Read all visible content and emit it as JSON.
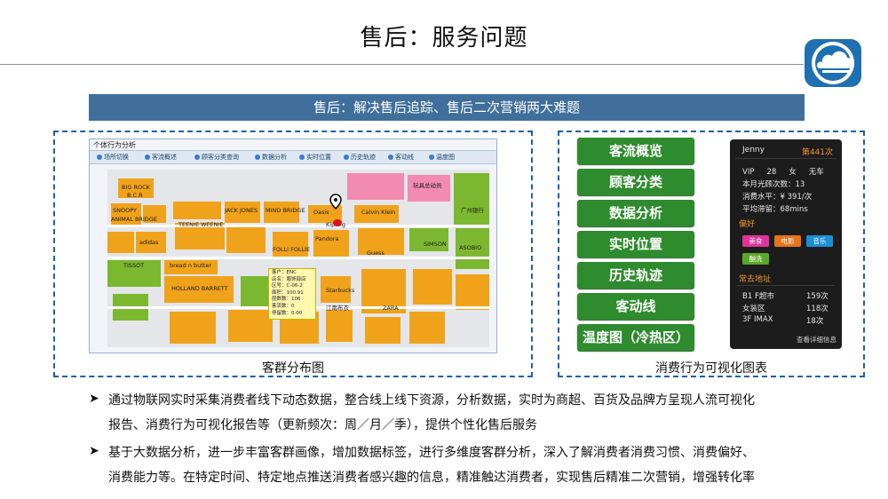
{
  "page": {
    "title": "售后：服务问题"
  },
  "banner": {
    "text": "售后：解决售后追踪、售后二次营销两大难题"
  },
  "map_window": {
    "title": "个体行为分析",
    "toolbar": [
      "场所切换",
      "客流概述",
      "顾客分类查询",
      "数据分析",
      "实时位置",
      "历史轨迹",
      "客动线",
      "温度图"
    ],
    "shops": [
      "BIG ROCK",
      "B.C.R",
      "SNOOPY",
      "ANIMAL BRIDGE",
      "TEENIE WEENIE",
      "adidas",
      "TISSOT",
      "bread n butter",
      "HOLLAND BARRETT",
      "JACK JONES",
      "MIND BRIDGE",
      "FOLLI FOLLIE",
      "Pandora",
      "Oasis",
      "Calvin Klein",
      "Guess",
      "Kipling",
      "ZARA",
      "ASOBIO",
      "SIMSON",
      "Starbucks",
      "江南布衣",
      "玩具总动员",
      "广州银行"
    ],
    "info_box": [
      "客户：ENC",
      "店名：服饰部店",
      "区号：C-06-2",
      "面积：100.91",
      "层数数：106",
      "客流数：0",
      "停留数：0.00"
    ]
  },
  "left_caption": "客群分布图",
  "right_caption": "消费行为可视化图表",
  "menu_buttons": [
    "客流概览",
    "顾客分类",
    "数据分析",
    "实时位置",
    "历史轨迹",
    "客动线",
    "温度图（冷热区）"
  ],
  "profile": {
    "name": "Jenny",
    "rank": "第441次",
    "vip": "VIP",
    "age": "28",
    "gender": "女",
    "car": "无车",
    "visits_label": "本月光顾次数：",
    "visits": "13",
    "spend_label": "消费水平：",
    "spend": "¥ 391/次",
    "stay_label": "平均滞留：",
    "stay": "68mins",
    "pref_title": "偏好",
    "tags": [
      {
        "label": "美食",
        "color": "#e0339a"
      },
      {
        "label": "电影",
        "color": "#e8731c"
      },
      {
        "label": "音乐",
        "color": "#1c8fd6"
      },
      {
        "label": "酗洗",
        "color": "#5aa82a"
      }
    ],
    "places_title": "常去地址",
    "places": [
      {
        "name": "B1 F超市",
        "count": "159次"
      },
      {
        "name": "女装区",
        "count": "118次"
      },
      {
        "name": "3F IMAX",
        "count": "18次"
      }
    ],
    "more": "查看详细信息"
  },
  "bullets": [
    {
      "lines": [
        "通过物联网实时采集消费者线下动态数据，整合线上线下资源，分析数据，实时为商超、百货及品牌方呈现人流可视化",
        "报告、消费行为可视化报告等（更新频次：周／月／季），提供个性化售后服务"
      ]
    },
    {
      "lines": [
        "基于大数据分析，进一步丰富客群画像，增加数据标签，进行多维度客群分析，深入了解消费者消费习惯、消费偏好、",
        "消费能力等。在特定时间、特定地点推送消费者感兴趣的信息，精准触达消费者，实现售后精准二次营销，增强转化率"
      ]
    }
  ],
  "colors": {
    "banner": "#3f6f9a",
    "panel_border": "#1e5fae",
    "button": "#2e8b2e",
    "card_bg": "#1c1c1c",
    "accent": "#f0952a",
    "shop_orange": "#f0a31a",
    "shop_green": "#7cb82f",
    "shop_pink": "#f28bb0"
  }
}
